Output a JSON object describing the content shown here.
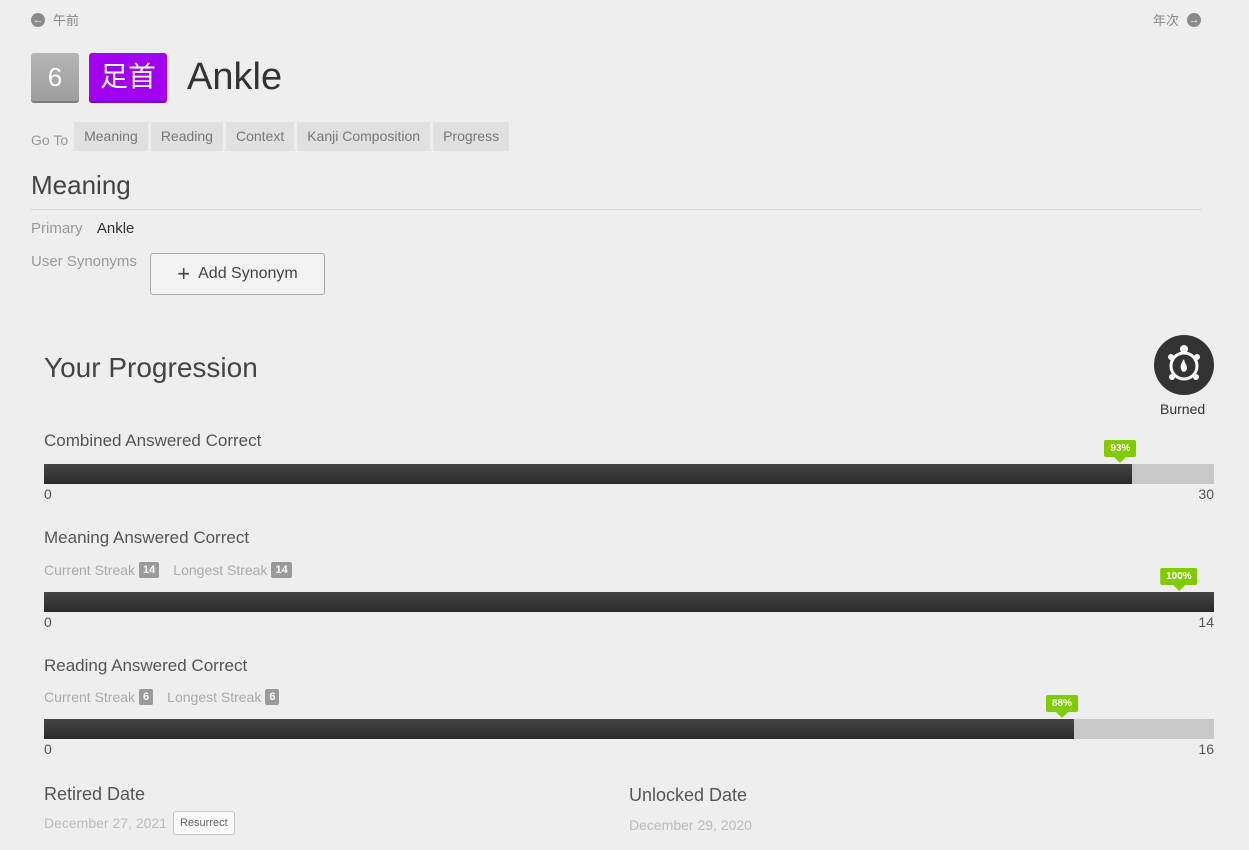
{
  "nav": {
    "prev_label": "午前",
    "next_label": "年次",
    "prev_icon": "arrow-left-circle-icon",
    "next_icon": "arrow-right-circle-icon"
  },
  "header": {
    "level": "6",
    "characters": "足首",
    "meaning": "Ankle",
    "kanji_color": "#a100f1"
  },
  "goto": {
    "label": "Go To",
    "links": [
      "Meaning",
      "Reading",
      "Context",
      "Kanji Composition",
      "Progress"
    ]
  },
  "meaning_section": {
    "title": "Meaning",
    "primary_label": "Primary",
    "primary_value": "Ankle",
    "synonyms_label": "User Synonyms",
    "add_synonym_label": "Add Synonym"
  },
  "progression": {
    "title": "Your Progression",
    "srs_stage": "Burned",
    "stats": [
      {
        "title": "Combined Answered Correct",
        "percent_label": "93%",
        "percent": 93,
        "min": "0",
        "max": "30"
      },
      {
        "title": "Meaning Answered Correct",
        "current_streak_label": "Current Streak",
        "current_streak": "14",
        "longest_streak_label": "Longest Streak",
        "longest_streak": "14",
        "percent_label": "100%",
        "percent": 100,
        "min": "0",
        "max": "14"
      },
      {
        "title": "Reading Answered Correct",
        "current_streak_label": "Current Streak",
        "current_streak": "6",
        "longest_streak_label": "Longest Streak",
        "longest_streak": "6",
        "percent_label": "88%",
        "percent": 88,
        "min": "0",
        "max": "16"
      }
    ],
    "accent_color": "#80cc00"
  },
  "dates": {
    "retired_title": "Retired Date",
    "retired_value": "December 27, 2021",
    "resurrect_label": "Resurrect",
    "unlocked_title": "Unlocked Date",
    "unlocked_value": "December 29, 2020"
  }
}
